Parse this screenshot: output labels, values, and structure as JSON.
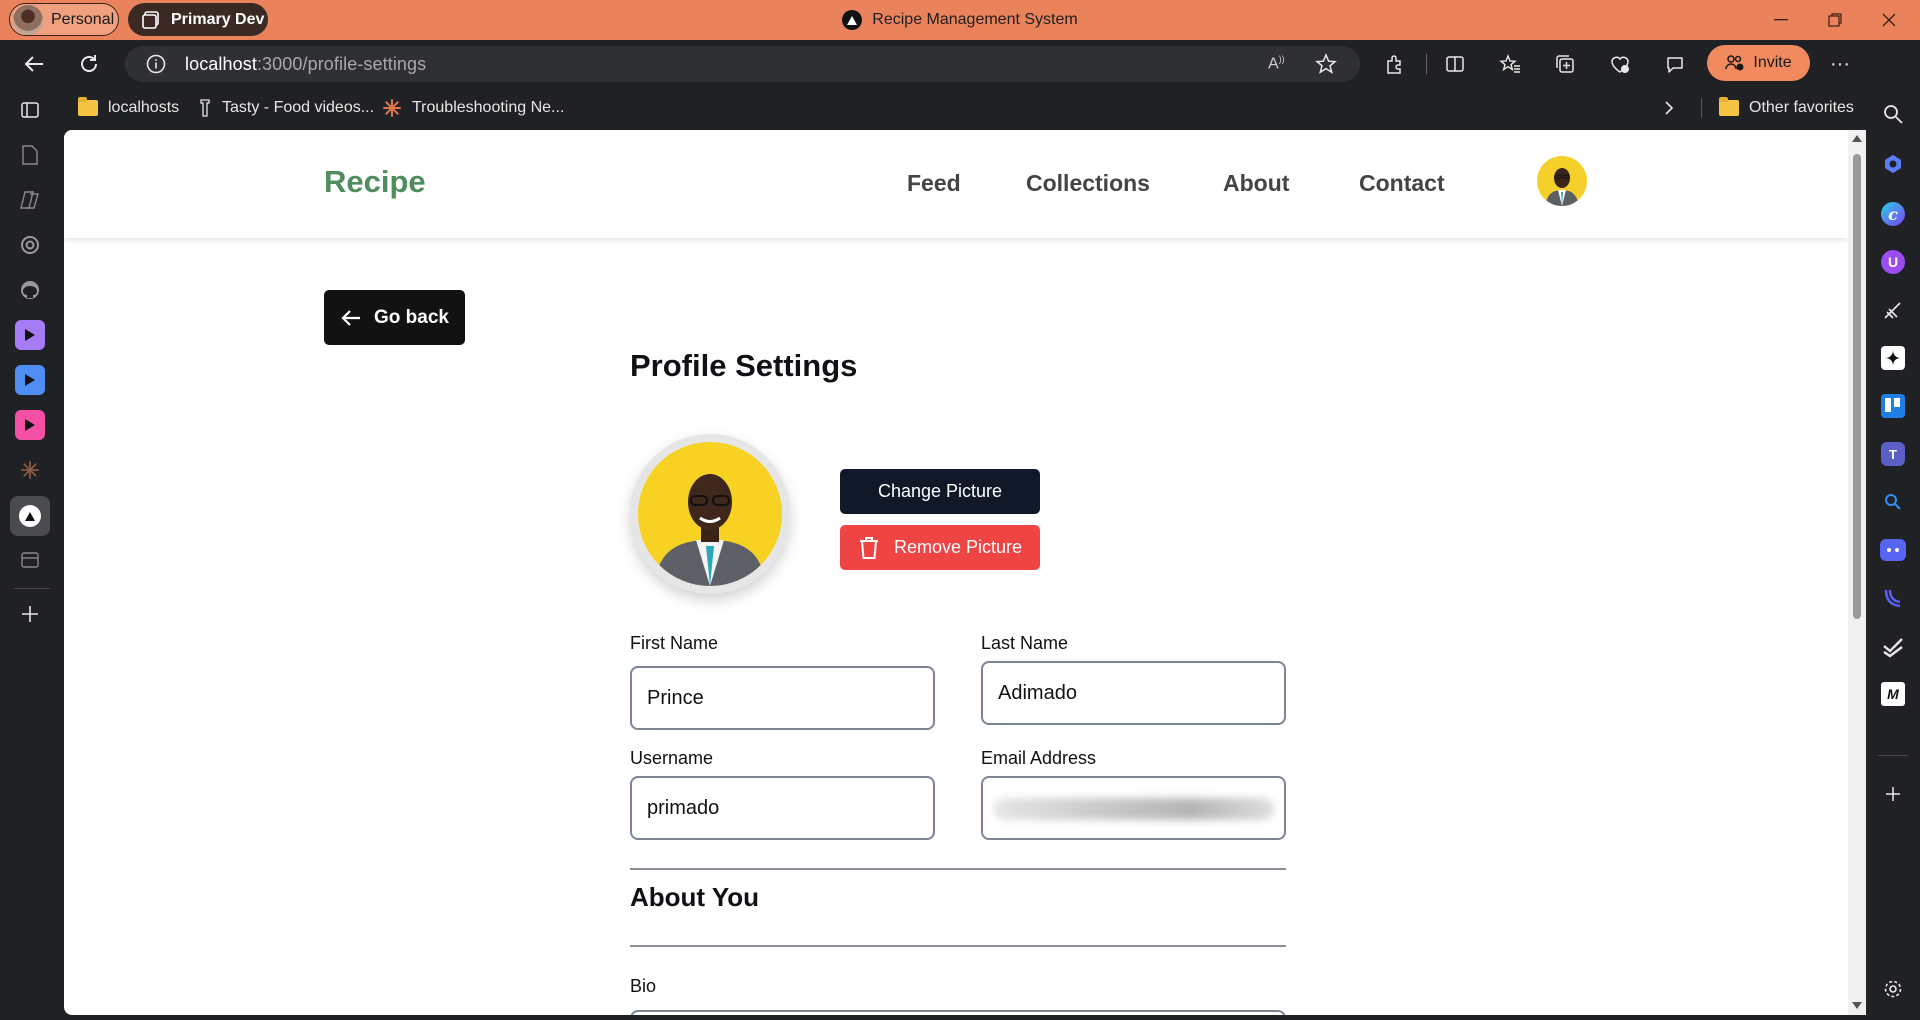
{
  "titlebar": {
    "profile_label": "Personal",
    "workspace_label": "Primary Dev",
    "window_title": "Recipe Management System",
    "controls": [
      "minimize-icon",
      "restore-icon",
      "close-icon"
    ]
  },
  "toolbar": {
    "url_host": "localhost",
    "url_path": ":3000/profile-settings",
    "invite_label": "Invite",
    "icons": [
      "back-icon",
      "refresh-icon",
      "site-info-icon",
      "read-aloud-icon",
      "favorite-star-icon",
      "extensions-icon",
      "split-screen-icon",
      "favorites-icon",
      "collections-icon",
      "browser-essentials-icon",
      "feedback-icon",
      "more-icon",
      "copilot-icon"
    ]
  },
  "bookmarks": {
    "items": [
      {
        "label": "localhosts",
        "icon": "folder-icon"
      },
      {
        "label": "Tasty - Food videos...",
        "icon": "tasty-icon"
      },
      {
        "label": "Troubleshooting Ne...",
        "icon": "claude-icon"
      }
    ],
    "other_label": "Other favorites"
  },
  "site": {
    "brand": "Recipe",
    "nav": [
      "Feed",
      "Collections",
      "About",
      "Contact"
    ],
    "accent_color": "#4f8c5e"
  },
  "page": {
    "go_back_label": "Go back",
    "title": "Profile Settings",
    "change_picture_label": "Change Picture",
    "remove_picture_label": "Remove Picture",
    "fields": {
      "first_name": {
        "label": "First Name",
        "value": "Prince"
      },
      "last_name": {
        "label": "Last Name",
        "value": "Adimado"
      },
      "username": {
        "label": "Username",
        "value": "primado"
      },
      "email": {
        "label": "Email Address",
        "value": ""
      }
    },
    "about_title": "About You",
    "bio_label": "Bio",
    "remove_color": "#ef4444",
    "change_color": "#111827"
  }
}
